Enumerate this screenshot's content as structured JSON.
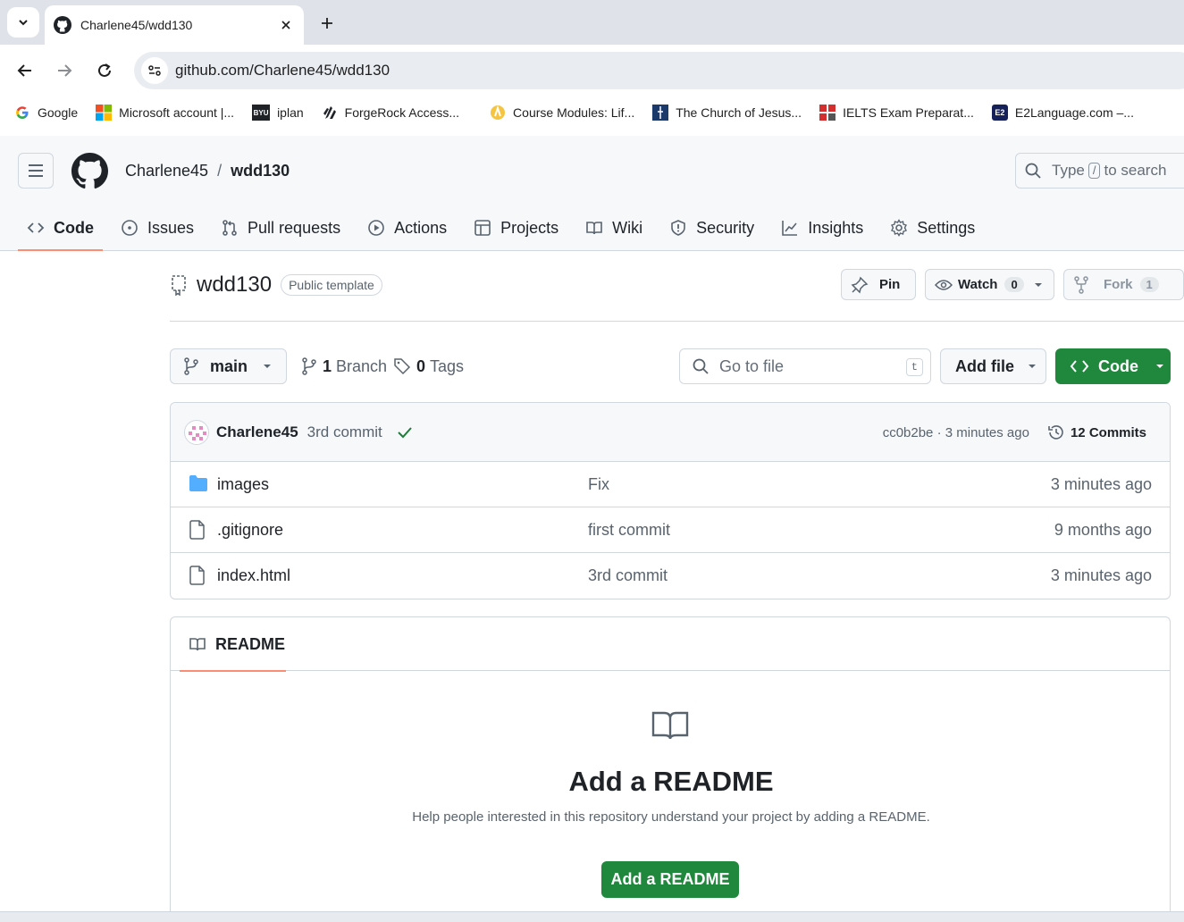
{
  "browser": {
    "tab_title": "Charlene45/wdd130",
    "url": "github.com/Charlene45/wdd130",
    "bookmarks": [
      {
        "label": "Google",
        "icon": "google-icon"
      },
      {
        "label": "Microsoft account |...",
        "icon": "microsoft-icon"
      },
      {
        "label": "iplan",
        "icon": "byu-icon"
      },
      {
        "label": "ForgeRock Access...",
        "icon": "forgerock-icon"
      },
      {
        "label": "Course Modules: Lif...",
        "icon": "course-icon"
      },
      {
        "label": "The Church of Jesus...",
        "icon": "church-icon"
      },
      {
        "label": "IELTS Exam Preparat...",
        "icon": "ielts-icon"
      },
      {
        "label": "E2Language.com –...",
        "icon": "e2-icon"
      }
    ]
  },
  "header": {
    "owner": "Charlene45",
    "separator": "/",
    "repo": "wdd130",
    "search_before": "Type",
    "search_key": "/",
    "search_after": "to search"
  },
  "repo_nav": [
    {
      "label": "Code",
      "icon": "code-icon"
    },
    {
      "label": "Issues",
      "icon": "issue-icon"
    },
    {
      "label": "Pull requests",
      "icon": "pull-request-icon"
    },
    {
      "label": "Actions",
      "icon": "play-icon"
    },
    {
      "label": "Projects",
      "icon": "table-icon"
    },
    {
      "label": "Wiki",
      "icon": "book-icon"
    },
    {
      "label": "Security",
      "icon": "shield-icon"
    },
    {
      "label": "Insights",
      "icon": "graph-icon"
    },
    {
      "label": "Settings",
      "icon": "gear-icon"
    }
  ],
  "repo": {
    "name": "wdd130",
    "visibility": "Public template",
    "pin_label": "Pin",
    "watch_label": "Watch",
    "watch_count": "0",
    "fork_label": "Fork",
    "fork_count": "1"
  },
  "file_nav": {
    "branch": "main",
    "branch_count": "1",
    "branch_label": "Branch",
    "tag_count": "0",
    "tag_label": "Tags",
    "goto_placeholder": "Go to file",
    "goto_key": "t",
    "add_file": "Add file",
    "code_button": "Code"
  },
  "latest_commit": {
    "author": "Charlene45",
    "message": "3rd commit",
    "hash_time": "cc0b2be · 3 minutes ago",
    "commits_label": "12 Commits"
  },
  "files": [
    {
      "name": "images",
      "type": "folder",
      "message": "Fix",
      "date": "3 minutes ago"
    },
    {
      "name": ".gitignore",
      "type": "file",
      "message": "first commit",
      "date": "9 months ago"
    },
    {
      "name": "index.html",
      "type": "file",
      "message": "3rd commit",
      "date": "3 minutes ago"
    }
  ],
  "readme": {
    "tab_label": "README",
    "heading": "Add a README",
    "description": "Help people interested in this repository understand your project by adding a README.",
    "button": "Add a README"
  },
  "colors": {
    "accent_green": "#1f883d",
    "underline": "#fd8c73",
    "folder_blue": "#54aeff"
  }
}
